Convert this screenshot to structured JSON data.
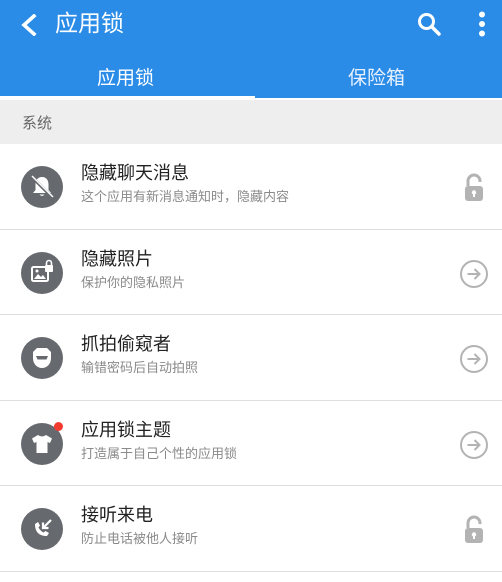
{
  "header": {
    "title": "应用锁",
    "icons": [
      "back-arrow-icon",
      "search-icon",
      "more-vert-icon"
    ]
  },
  "tabs": [
    {
      "label": "应用锁",
      "selected": true
    },
    {
      "label": "保险箱",
      "selected": false
    }
  ],
  "section": {
    "label": "系统"
  },
  "items": [
    {
      "title": "隐藏聊天消息",
      "subtitle": "这个应用有新消息通知时，隐藏内容",
      "icon": "muted-bell-icon",
      "action": "unlocked-padlock-icon"
    },
    {
      "title": "隐藏照片",
      "subtitle": "保护你的隐私照片",
      "icon": "locked-photo-icon",
      "action": "arrow-circle-right-icon"
    },
    {
      "title": "抓拍偷窥者",
      "subtitle": "输错密码后自动拍照",
      "icon": "spy-face-icon",
      "action": "arrow-circle-right-icon"
    },
    {
      "title": "应用锁主题",
      "subtitle": "打造属于自己个性的应用锁",
      "icon": "tshirt-icon",
      "action": "arrow-circle-right-icon",
      "badge": true
    },
    {
      "title": "接听来电",
      "subtitle": "防止电话被他人接听",
      "icon": "incoming-call-icon",
      "action": "unlocked-padlock-icon"
    }
  ],
  "colors": {
    "accent": "#2b8ce8",
    "section_bg": "#eeeeee",
    "icon_bg": "#666a6e",
    "badge": "#f23b2f",
    "action_icon": "#b3b3b3"
  }
}
